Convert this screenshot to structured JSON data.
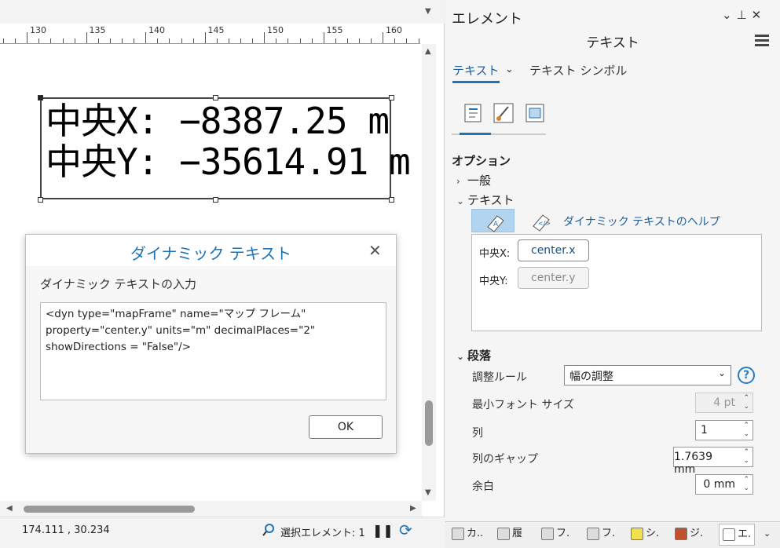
{
  "ruler": {
    "labels": [
      "130",
      "135",
      "140",
      "145",
      "150",
      "155",
      "160"
    ]
  },
  "map_text": {
    "line1": "中央X: −8387.25 m",
    "line2": "中央Y: −35614.91 m"
  },
  "dialog": {
    "title": "ダイナミック テキスト",
    "prompt": "ダイナミック テキストの入力",
    "content": "<dyn type=\"mapFrame\" name=\"マップ フレーム\"\nproperty=\"center.y\" units=\"m\" decimalPlaces=\"2\"\nshowDirections = \"False\"/>",
    "ok_label": "OK"
  },
  "statusbar": {
    "coords": "174.111 , 30.234",
    "selected": "選択エレメント: 1"
  },
  "pane": {
    "title": "エレメント",
    "subtitle": "テキスト",
    "tabs": {
      "text": "テキスト",
      "symbol": "テキスト シンボル"
    },
    "options_header": "オプション",
    "general": "一般",
    "text_section": "テキスト",
    "dynamic_help": "ダイナミック テキストのヘルプ",
    "text_rows": [
      {
        "label": "中央X:",
        "token": "center.x"
      },
      {
        "label": "中央Y:",
        "token": "center.y"
      }
    ],
    "paragraph": "段落",
    "props": {
      "align_rule_label": "調整ルール",
      "align_rule_value": "幅の調整",
      "min_font_label": "最小フォント サイズ",
      "min_font_value": "4 pt",
      "columns_label": "列",
      "columns_value": "1",
      "column_gap_label": "列のギャップ",
      "column_gap_value": "1.7639 mm",
      "margin_label": "余白",
      "margin_value": "0 mm"
    }
  },
  "bottom_tabs": [
    "カ..",
    "履",
    "フ.",
    "フ.",
    "シ.",
    "ジ.",
    "エ."
  ],
  "colors": {
    "accent": "#1e73b4",
    "selected_button": "#b3d4ef"
  }
}
